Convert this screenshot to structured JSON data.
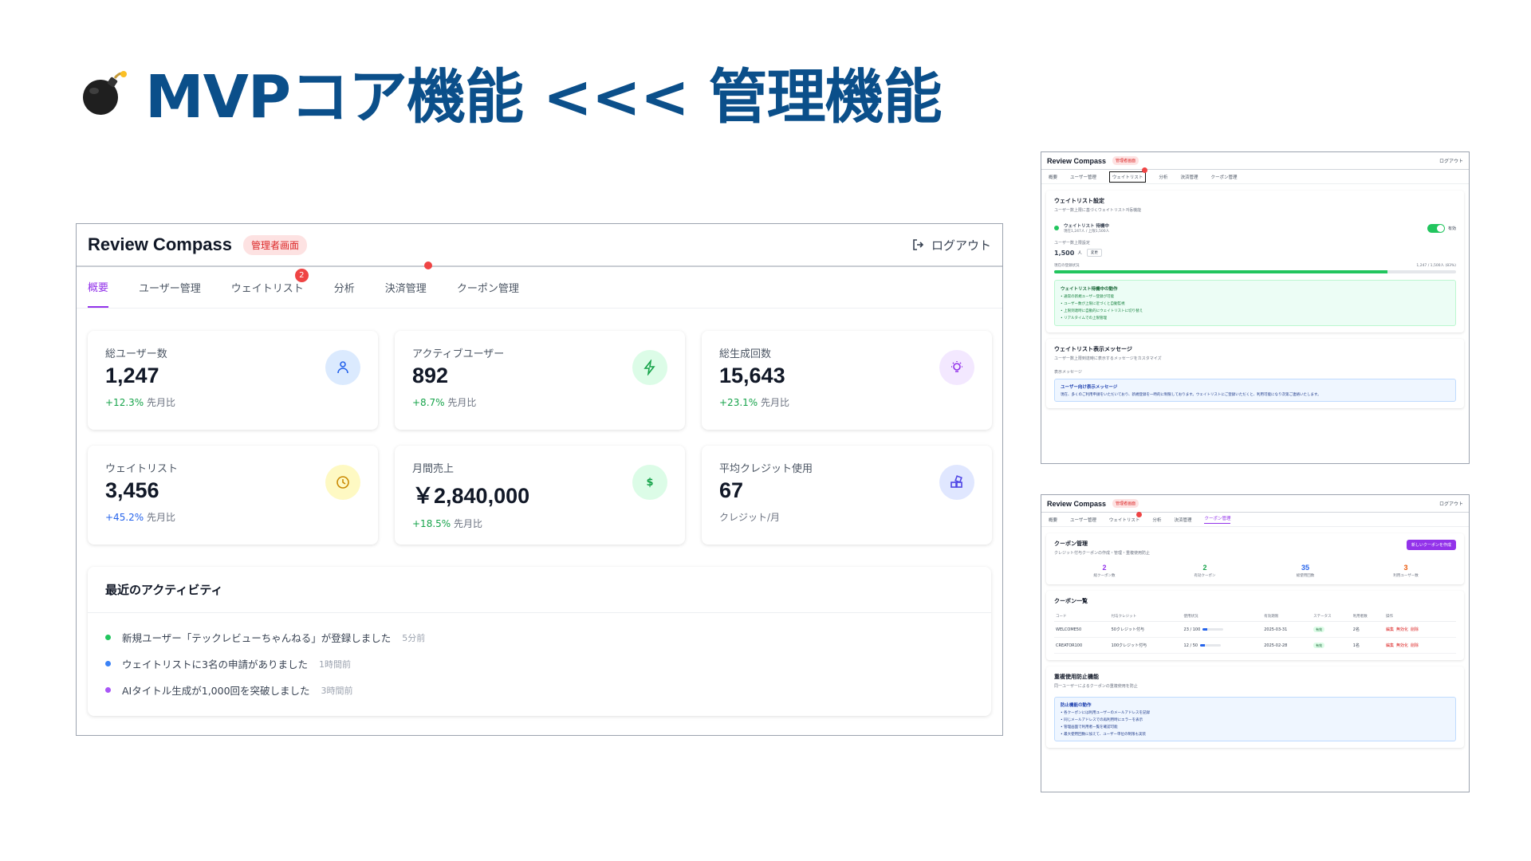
{
  "slide": {
    "title": "MVPコア機能 <<< 管理機能",
    "icon": "bomb-emoji"
  },
  "main": {
    "brand": "Review Compass",
    "badge": "管理者画面",
    "logout": "ログアウト",
    "tabs": [
      {
        "label": "概要",
        "active": true
      },
      {
        "label": "ユーザー管理"
      },
      {
        "label": "ウェイトリスト",
        "badge": "2"
      },
      {
        "label": "分析"
      },
      {
        "label": "決済管理"
      },
      {
        "label": "クーポン管理"
      }
    ],
    "cards": [
      {
        "label": "総ユーザー数",
        "value": "1,247",
        "change": "+12.3%",
        "suffix": "先月比",
        "icon": "user-icon",
        "color": "#2563eb",
        "bg": "#dbeafe"
      },
      {
        "label": "アクティブユーザー",
        "value": "892",
        "change": "+8.7%",
        "suffix": "先月比",
        "icon": "lightning-icon",
        "color": "#16a34a",
        "bg": "#dcfce7"
      },
      {
        "label": "総生成回数",
        "value": "15,643",
        "change": "+23.1%",
        "suffix": "先月比",
        "icon": "lightbulb-icon",
        "color": "#9333ea",
        "bg": "#f3e8ff"
      },
      {
        "label": "ウェイトリスト",
        "value": "3,456",
        "change": "+45.2%",
        "suffix": "先月比",
        "icon": "clock-icon",
        "color": "#ca8a04",
        "bg": "#fef9c3"
      },
      {
        "label": "月間売上",
        "value": "￥2,840,000",
        "change": "+18.5%",
        "suffix": "先月比",
        "icon": "dollar-icon",
        "color": "#16a34a",
        "bg": "#dcfce7"
      },
      {
        "label": "平均クレジット使用",
        "value": "67",
        "change": "",
        "suffix": "クレジット/月",
        "icon": "blocks-icon",
        "color": "#4f46e5",
        "bg": "#e0e7ff"
      }
    ],
    "activity": {
      "title": "最近のアクティビティ",
      "items": [
        {
          "text": "新規ユーザー「テックレビューちゃんねる」が登録しました",
          "time": "5分前",
          "color": "#22c55e"
        },
        {
          "text": "ウェイトリストに3名の申請がありました",
          "time": "1時間前",
          "color": "#3b82f6"
        },
        {
          "text": "AIタイトル生成が1,000回を突破しました",
          "time": "3時間前",
          "color": "#a855f7"
        }
      ]
    }
  },
  "waitlist_shot": {
    "brand": "Review Compass",
    "badge": "管理者画面",
    "logout": "ログアウト",
    "tabs": [
      "概要",
      "ユーザー管理",
      "ウェイトリスト",
      "分析",
      "決済管理",
      "クーポン管理"
    ],
    "settings_title": "ウェイトリスト設定",
    "settings_desc": "ユーザー数上限に基づくウェイトリスト자동機能",
    "status_label": "ウェイトリスト 待機中",
    "status_sub": "現在1,247人 / 上限1,500人",
    "toggle_label": "有効",
    "limit_label": "ユーザー数上限設定",
    "limit_value": "1,500",
    "limit_unit": "人",
    "change_button": "変更",
    "progress_label": "現在の登録状況",
    "progress_text": "1,247 / 1,500人 (83%)",
    "progress": 0.83,
    "behavior_title": "ウェイトリスト待機中の動作",
    "behavior_items": [
      "• 通常の新規ユーザー登録が可能",
      "• ユーザー数が上限に近づくと自動監視",
      "• 上限到達時に自動的にウェイトリストに切り替え",
      "• リアルタイムでの上限管理"
    ],
    "message_title": "ウェイトリスト表示メッセージ",
    "message_desc": "ユーザー数上限到達時に表示するメッセージをカスタマイズ",
    "message_label": "表示メッセージ",
    "message_box_title": "ユーザー向け表示メッセージ",
    "message_box_text": "現在、多くのご利用申請をいただいており、新規登録を一時的に制限しております。ウェイトリストにご登録いただくと、利用可能になり次第ご連絡いたします。"
  },
  "coupon_shot": {
    "brand": "Review Compass",
    "badge": "管理者画面",
    "logout": "ログアウト",
    "tabs": [
      "概要",
      "ユーザー管理",
      "ウェイトリスト",
      "分析",
      "決済管理",
      "クーポン管理"
    ],
    "title": "クーポン管理",
    "desc": "クレジット付与クーポンの作成・管理・重複使用防止",
    "new_button": "新しいクーポンを作成",
    "stats": [
      {
        "value": "2",
        "label": "総クーポン数",
        "color": "#9333ea"
      },
      {
        "value": "2",
        "label": "有効クーポン",
        "color": "#16a34a"
      },
      {
        "value": "35",
        "label": "総使用回数",
        "color": "#2563eb"
      },
      {
        "value": "3",
        "label": "利用ユーザー数",
        "color": "#ea580c"
      }
    ],
    "list_title": "クーポン一覧",
    "columns": [
      "コード",
      "付与クレジット",
      "使用状況",
      "有効期限",
      "ステータス",
      "利用者数",
      "操作"
    ],
    "rows": [
      {
        "code": "WELCOME50",
        "credit": "50クレジット付与",
        "usage": "23 / 100",
        "usage_frac": 0.23,
        "expiry": "2025-03-31",
        "status": "有効",
        "users": "2名",
        "ops": [
          "編集",
          "無効化",
          "削除"
        ]
      },
      {
        "code": "CREATOR100",
        "credit": "100クレジット付与",
        "usage": "12 / 50",
        "usage_frac": 0.24,
        "expiry": "2025-02-28",
        "status": "有効",
        "users": "1名",
        "ops": [
          "編集",
          "無効化",
          "削除"
        ]
      }
    ],
    "dup_title": "重複使用防止機能",
    "dup_desc": "同一ユーザーによるクーポンの重複使用を防止",
    "dup_box_title": "防止機能の動作",
    "dup_items": [
      "• 各クーポンには利用ユーザーのメールアドレスを記録",
      "• 同じメールアドレスでの再利用時にエラーを表示",
      "• 管理画面で利用者一覧を確認可能",
      "• 最大使用回数に加えて、ユーザー単位の制限も実装"
    ]
  }
}
